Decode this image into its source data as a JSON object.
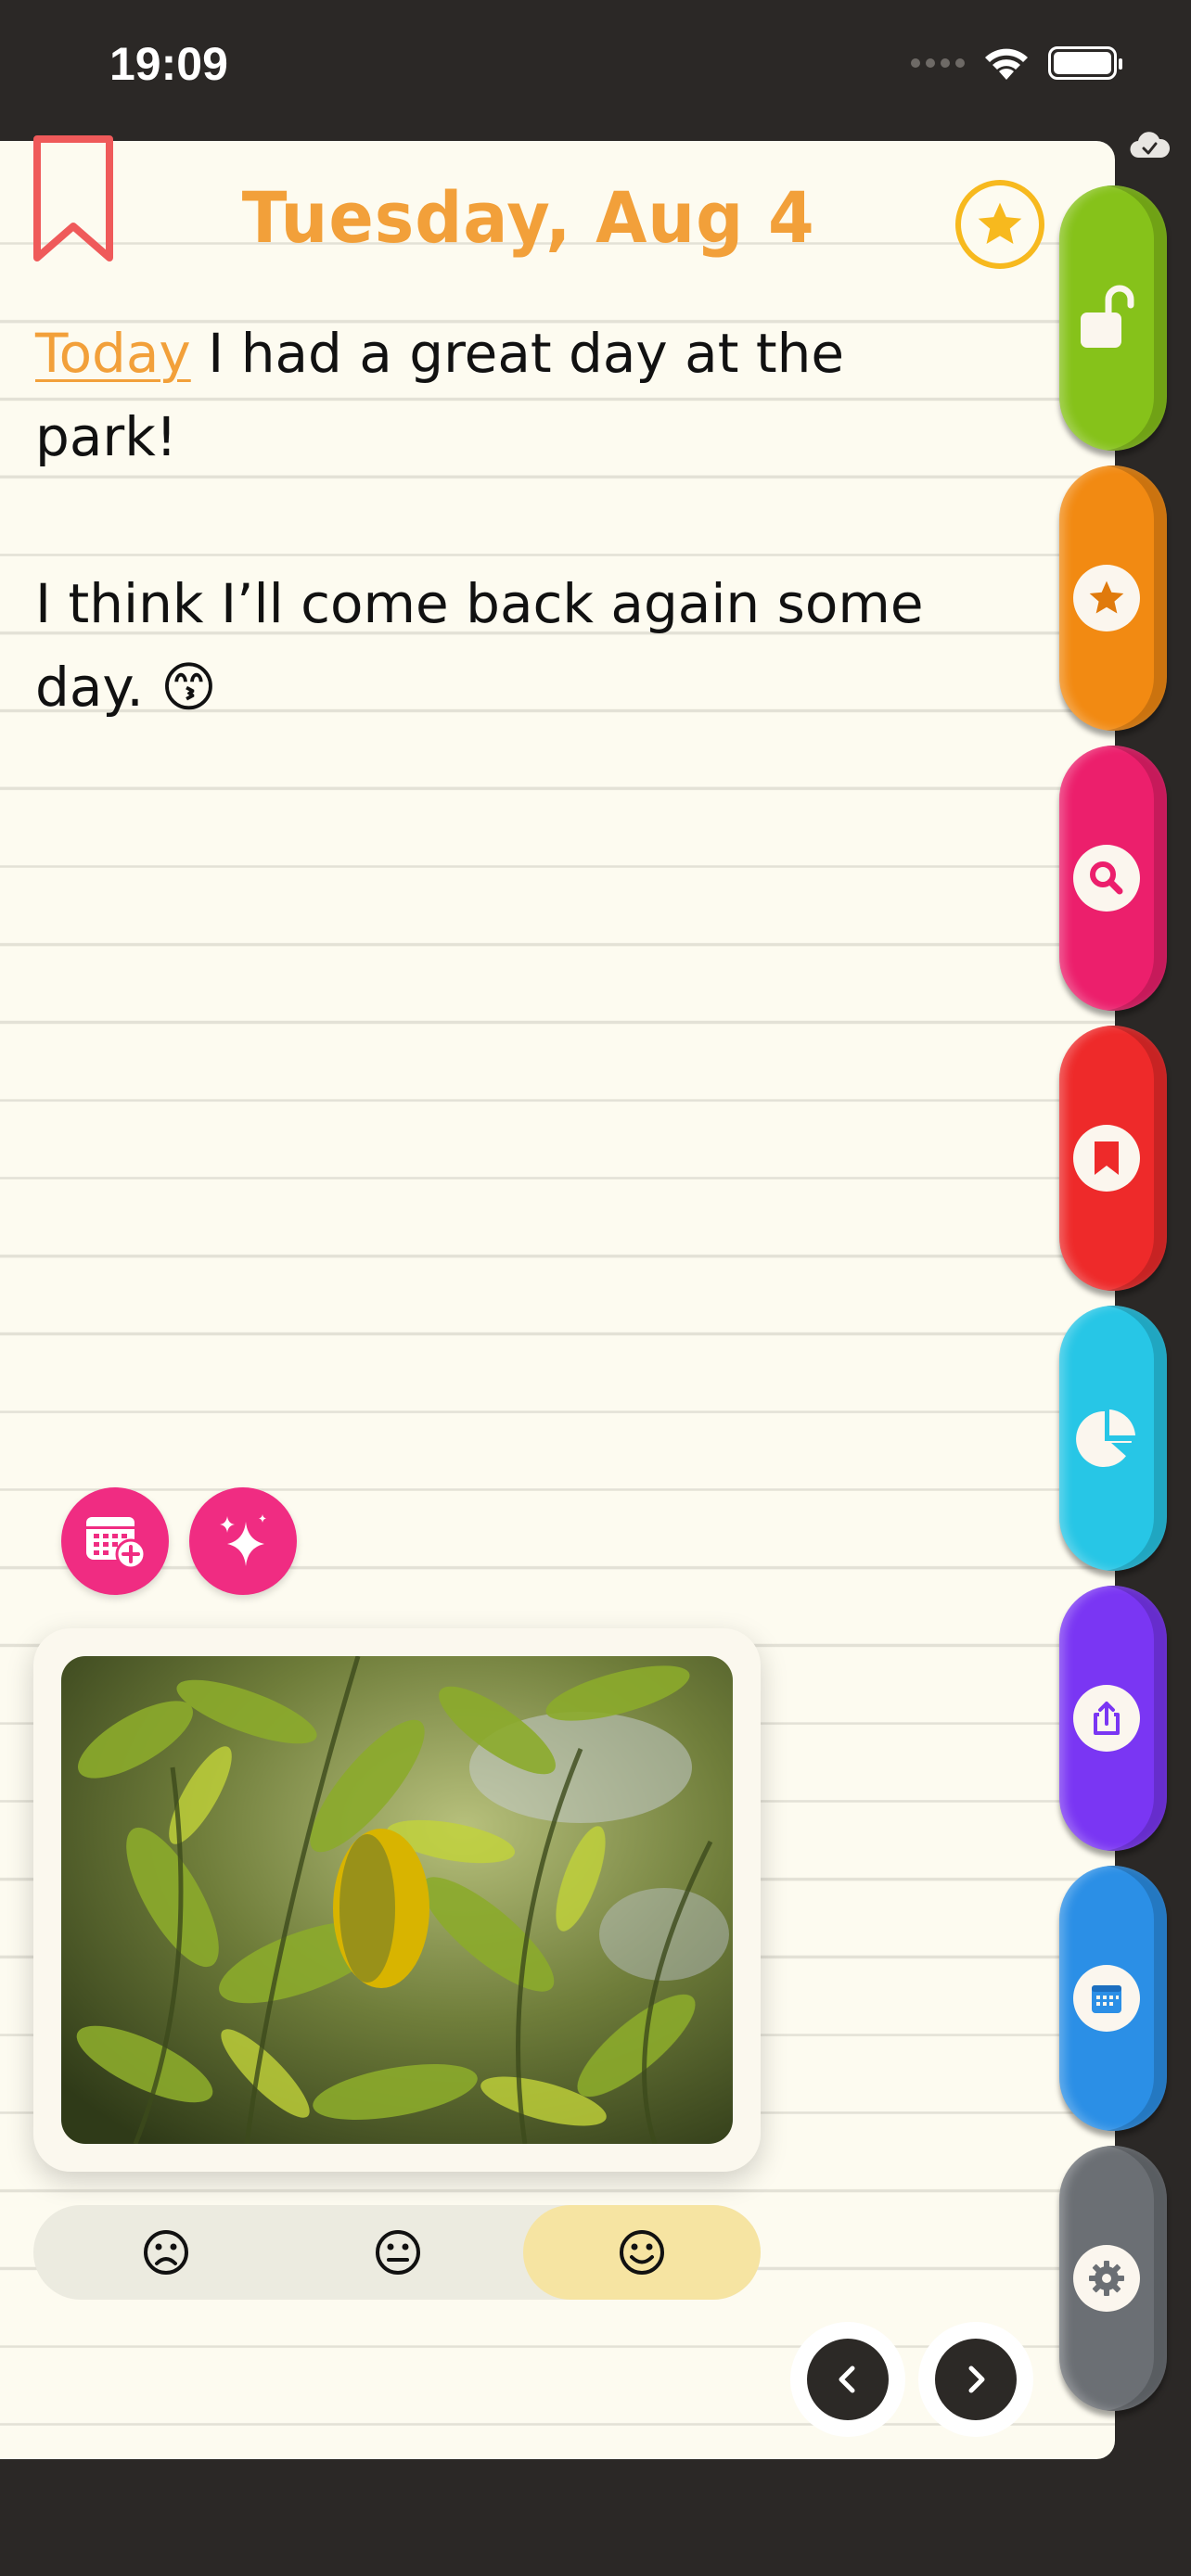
{
  "status_bar": {
    "time": "19:09"
  },
  "header": {
    "date": "Tuesday, Aug 4"
  },
  "entry": {
    "line1_link": "Today",
    "line1_rest": " I had a great day at the park!",
    "line2": "I think I’ll come back again some day. 😙"
  },
  "mood": {
    "options": [
      "☹",
      "😐",
      "☺"
    ],
    "selected_index": 2
  },
  "side_tabs": [
    {
      "name": "lock",
      "color": "#86c21a",
      "icon": "unlock-icon"
    },
    {
      "name": "favorites",
      "color": "#f28a12",
      "icon": "star-icon"
    },
    {
      "name": "search",
      "color": "#ec1f6c",
      "icon": "search-icon"
    },
    {
      "name": "bookmarks",
      "color": "#ee2a2a",
      "icon": "bookmark-icon"
    },
    {
      "name": "stats",
      "color": "#27c6e6",
      "icon": "pie-chart-icon"
    },
    {
      "name": "share",
      "color": "#7a36f3",
      "icon": "share-icon"
    },
    {
      "name": "calendar",
      "color": "#2b8fe6",
      "icon": "calendar-icon"
    },
    {
      "name": "settings",
      "color": "#6b6f74",
      "icon": "gear-icon"
    }
  ],
  "colors": {
    "accent_orange": "#f2a03a",
    "star_yellow": "#f7b91e",
    "bookmark_red": "#ef5a5a",
    "action_pink": "#f02c82",
    "page_bg": "#fdfbf0"
  }
}
